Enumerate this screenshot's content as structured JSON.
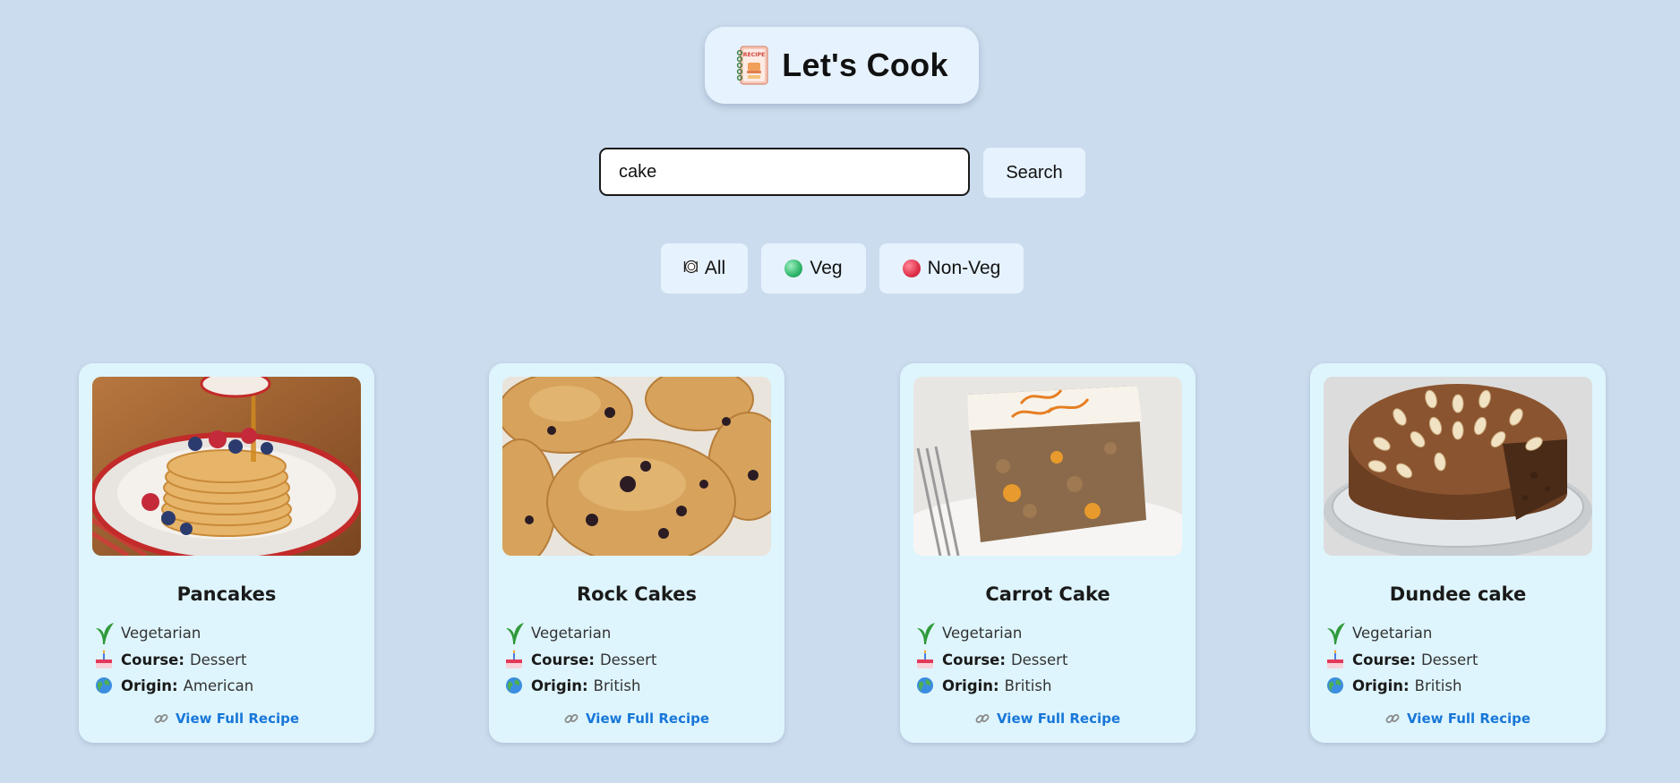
{
  "header": {
    "title": "Let's Cook",
    "icon": "recipe-book-icon",
    "icon_text": "RECIPE"
  },
  "search": {
    "value": "cake",
    "placeholder": "",
    "button_label": "Search"
  },
  "filters": [
    {
      "label": "All",
      "icon": "plate-icon"
    },
    {
      "label": "Veg",
      "icon": "green-dot-icon",
      "color": "#2fb56b"
    },
    {
      "label": "Non-Veg",
      "icon": "red-dot-icon",
      "color": "#e0304a"
    }
  ],
  "colors": {
    "background": "#cbdcee",
    "card": "#def5fd",
    "button": "#e6f2fd",
    "link": "#1877d8"
  },
  "cards": [
    {
      "title": "Pancakes",
      "diet": "Vegetarian",
      "course_label": "Course:",
      "course": "Dessert",
      "origin_label": "Origin:",
      "origin": "American",
      "link": "View Full Recipe",
      "image": "pancakes-photo"
    },
    {
      "title": "Rock Cakes",
      "diet": "Vegetarian",
      "course_label": "Course:",
      "course": "Dessert",
      "origin_label": "Origin:",
      "origin": "British",
      "link": "View Full Recipe",
      "image": "rock-cakes-photo"
    },
    {
      "title": "Carrot Cake",
      "diet": "Vegetarian",
      "course_label": "Course:",
      "course": "Dessert",
      "origin_label": "Origin:",
      "origin": "British",
      "link": "View Full Recipe",
      "image": "carrot-cake-photo"
    },
    {
      "title": "Dundee cake",
      "diet": "Vegetarian",
      "course_label": "Course:",
      "course": "Dessert",
      "origin_label": "Origin:",
      "origin": "British",
      "link": "View Full Recipe",
      "image": "dundee-cake-photo"
    }
  ]
}
